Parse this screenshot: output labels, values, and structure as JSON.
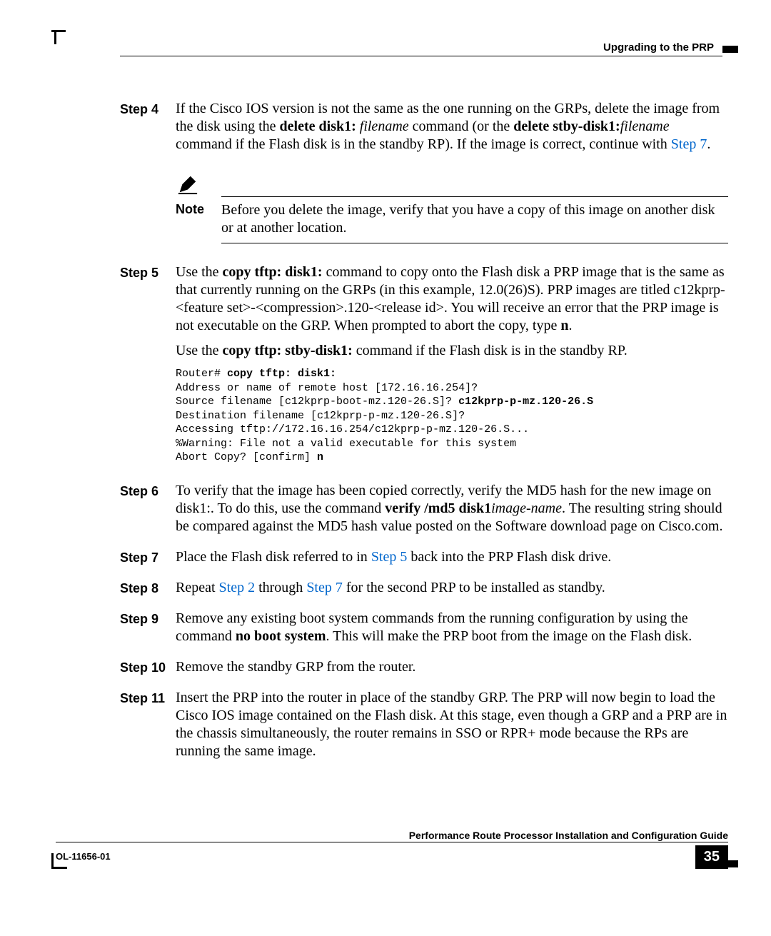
{
  "header": {
    "running_head": "Upgrading to the PRP"
  },
  "steps": {
    "s4": {
      "label": "Step 4",
      "p1_a": "If the Cisco IOS version is not the same as the one running on the GRPs, delete the image from the disk using the ",
      "p1_b": "delete disk1:",
      "p1_c": " filename",
      "p1_d": " command (or the ",
      "p1_e": "delete stby-disk1:",
      "p1_f": "filename",
      "p1_g": " command if the Flash disk is in the standby RP). If the image is correct, continue with ",
      "p1_h": "Step 7",
      "p1_i": "."
    },
    "note": {
      "label": "Note",
      "text": "Before you delete the image, verify that you have a copy of this image on another disk or at another location."
    },
    "s5": {
      "label": "Step 5",
      "p1_a": "Use the ",
      "p1_b": "copy tftp: disk1:",
      "p1_c": " command to copy onto the Flash disk a PRP image that is the same as that currently running on the GRPs (in this example, 12.0(26)S). PRP images are titled c12kprp-<feature set>-<compression>.120-<release id>. You will receive an error that the PRP image is not executable on the GRP. When prompted to abort the copy, type ",
      "p1_d": "n",
      "p1_e": ".",
      "p2_a": "Use the ",
      "p2_b": "copy tftp: stby-disk1:",
      "p2_c": " command if the Flash disk is in the standby RP.",
      "code_l1a": "Router# ",
      "code_l1b": "copy tftp: disk1:",
      "code_l2": "Address or name of remote host [172.16.16.254]?",
      "code_l3a": "Source filename [c12kprp-boot-mz.120-26.S]? ",
      "code_l3b": "c12kprp-p-mz.120-26.S",
      "code_l4": "Destination filename [c12kprp-p-mz.120-26.S]?",
      "code_l5": "Accessing tftp://172.16.16.254/c12kprp-p-mz.120-26.S...",
      "code_l6": "%Warning: File not a valid executable for this system",
      "code_l7a": "Abort Copy? [confirm] ",
      "code_l7b": "n"
    },
    "s6": {
      "label": "Step 6",
      "p_a": "To verify that the image has been copied correctly, verify the MD5 hash for the new image on disk1:. To do this, use the command ",
      "p_b": "verify /md5 disk1",
      "p_c": "image-name",
      "p_d": ". The resulting string should be compared against the MD5 hash value posted on the Software download page on Cisco.com."
    },
    "s7": {
      "label": "Step 7",
      "p_a": "Place the Flash disk referred to in ",
      "p_b": "Step 5",
      "p_c": " back into the PRP Flash disk drive."
    },
    "s8": {
      "label": "Step 8",
      "p_a": "Repeat ",
      "p_b": "Step 2",
      "p_c": " through ",
      "p_d": "Step 7",
      "p_e": " for the second PRP to be installed as standby."
    },
    "s9": {
      "label": "Step 9",
      "p_a": "Remove any existing boot system commands from the running configuration by using the command ",
      "p_b": "no boot system",
      "p_c": ". This will make the PRP boot from the image on the Flash disk."
    },
    "s10": {
      "label": "Step 10",
      "p": "Remove the standby GRP from the router."
    },
    "s11": {
      "label": "Step 11",
      "p": "Insert the PRP into the router in place of the standby GRP. The PRP will now begin to load the Cisco IOS image contained on the Flash disk. At this stage, even though a GRP and a PRP are in the chassis simultaneously, the router remains in SSO or RPR+ mode because the RPs are running the same image."
    }
  },
  "footer": {
    "doc_title": "Performance Route Processor Installation and Configuration Guide",
    "doc_id": "OL-11656-01",
    "page_num": "35"
  }
}
